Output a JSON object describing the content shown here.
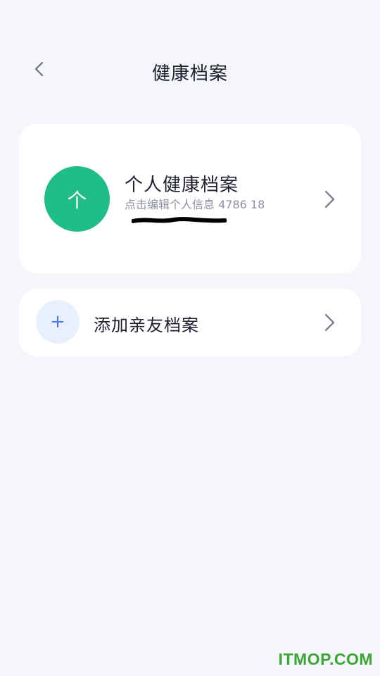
{
  "header": {
    "title": "健康档案",
    "back_icon": "chevron-left-icon"
  },
  "personal": {
    "avatar_glyph": "个",
    "title": "个人健康档案",
    "subtitle": "点击编辑个人信息 4786 18",
    "arrow_icon": "chevron-right-icon",
    "avatar_color": "#1FBE89"
  },
  "family": {
    "plus_glyph": "+",
    "title": "添加亲友档案",
    "arrow_icon": "chevron-right-icon",
    "plus_bg_color": "#E9F0FD",
    "plus_color": "#4A7BE6"
  },
  "watermark": "ITMOP.COM"
}
